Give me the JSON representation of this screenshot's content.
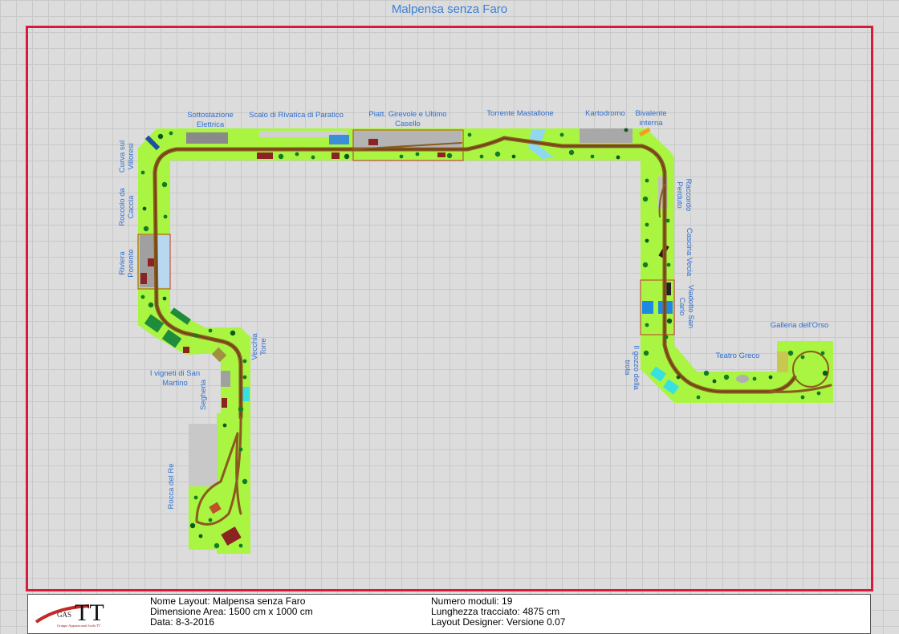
{
  "title": "Malpensa senza Faro",
  "colors": {
    "frame": "#d81b3c",
    "module_base": "#a9f542",
    "track": "#8b5a1e",
    "label": "#2f6fd0",
    "grid": "#c9c9c9"
  },
  "labels": {
    "sottostazione": "Sottostazione Elettrica",
    "scalo": "Scalo di Rivatica di Paratico",
    "piatt": "Piatt. Girevole e Ultimo Casello",
    "torrente": "Torrente Mastallone",
    "kartodromo": "Kartodromo",
    "bivalente": "Bivalente interna",
    "curva": "Curva sul Villoresi",
    "roccolo": "Roccolo da Caccia",
    "riviera": "Riviera Ponente",
    "vigneti": "I vigneti di San Martino",
    "segheria": "Segheria",
    "vecchia_torre": "Vecchia Torre",
    "rocca": "Rocca del Re",
    "raccordo": "Raccordo Perduto",
    "cascina": "Cascina Vecia",
    "viadotto": "Viadotto San Carlo",
    "gozzo": "Il gozzo della trota",
    "teatro": "Teatro Greco",
    "galleria": "Galleria dell'Orso"
  },
  "logo": {
    "brand": "TT",
    "prefix": "GAS",
    "tagline": "Gruppo Appassionati Scala TT"
  },
  "info": {
    "nome": "Nome Layout: Malpensa senza Faro",
    "dimensione": "Dimensione Area: 1500 cm x 1000 cm",
    "data": "Data: 8-3-2016",
    "moduli": "Numero moduli: 19",
    "lunghezza": "Lunghezza tracciato: 4875 cm",
    "designer": "Layout Designer: Versione 0.07"
  }
}
